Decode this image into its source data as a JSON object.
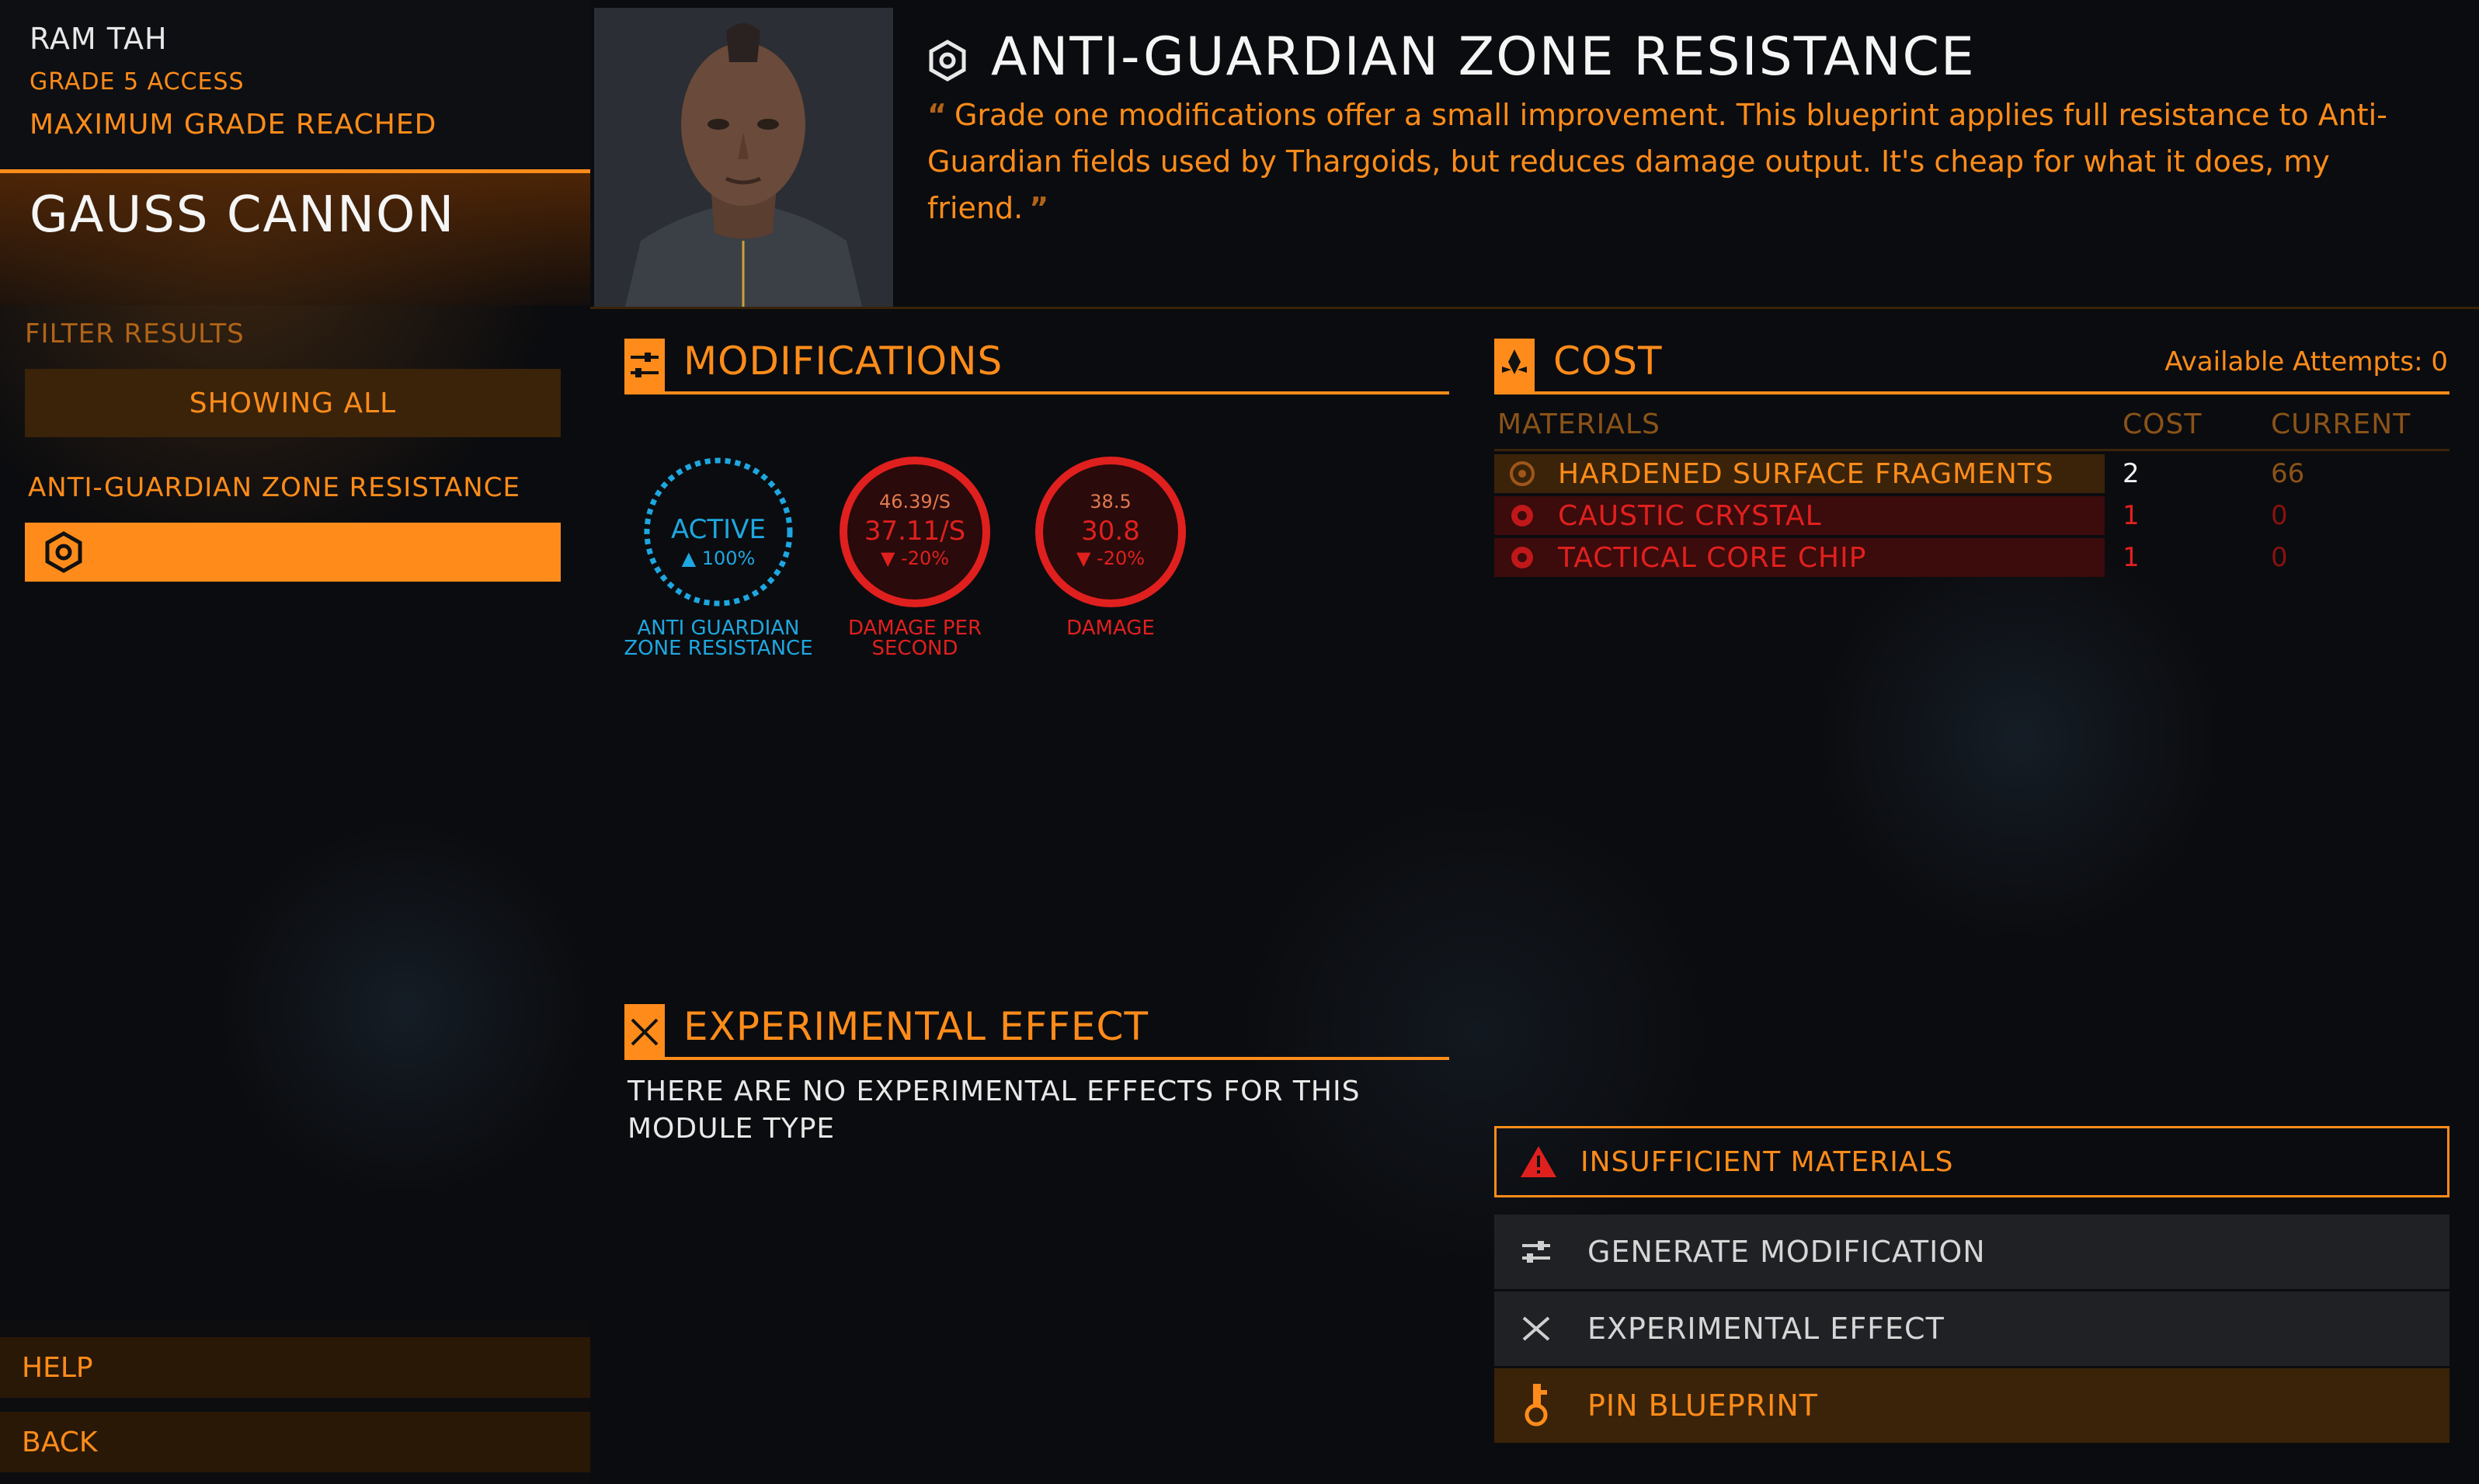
{
  "engineer": {
    "name": "RAM TAH",
    "grade_access": "GRADE 5 ACCESS",
    "status": "MAXIMUM GRADE REACHED"
  },
  "module": {
    "name": "GAUSS CANNON"
  },
  "filter": {
    "label": "FILTER RESULTS",
    "button_label": "SHOWING ALL"
  },
  "blueprint_list": {
    "group_label": "ANTI-GUARDIAN ZONE RESISTANCE",
    "selected_icon": "hexagon-icon"
  },
  "footer": {
    "help_label": "HELP",
    "back_label": "BACK"
  },
  "blueprint": {
    "title": "ANTI-GUARDIAN ZONE RESISTANCE",
    "quote_open": "“",
    "description": "Grade one modifications offer a small improvement. This blueprint applies full resistance to Anti-Guardian fields used by Thargoids, but reduces damage output. It's cheap for what it does, my friend.",
    "quote_close": "”"
  },
  "modifications": {
    "title": "MODIFICATIONS",
    "gauges": [
      {
        "main": "ACTIVE",
        "delta": "▲ 100%",
        "caption": "ANTI GUARDIAN ZONE RESISTANCE",
        "color": "#1ea7e1"
      },
      {
        "old": "46.39/S",
        "main": "37.11/S",
        "delta": "▼ -20%",
        "caption": "DAMAGE PER SECOND",
        "color": "#e0201e"
      },
      {
        "old": "38.5",
        "main": "30.8",
        "delta": "▼ -20%",
        "caption": "DAMAGE",
        "color": "#e0201e"
      }
    ]
  },
  "experimental": {
    "title": "EXPERIMENTAL EFFECT",
    "message": "THERE ARE NO EXPERIMENTAL EFFECTS FOR THIS MODULE TYPE"
  },
  "cost": {
    "title": "COST",
    "attempts": "Available Attempts: 0",
    "columns": [
      "MATERIALS",
      "COST",
      "CURRENT"
    ],
    "materials": [
      {
        "name": "HARDENED SURFACE FRAGMENTS",
        "cost": "2",
        "current": "66",
        "sufficient": true
      },
      {
        "name": "CAUSTIC CRYSTAL",
        "cost": "1",
        "current": "0",
        "sufficient": false
      },
      {
        "name": "TACTICAL CORE CHIP",
        "cost": "1",
        "current": "0",
        "sufficient": false
      }
    ]
  },
  "actions": {
    "alert": "INSUFFICIENT MATERIALS",
    "generate": "GENERATE MODIFICATION",
    "experimental": "EXPERIMENTAL EFFECT",
    "pin": "PIN BLUEPRINT"
  },
  "colors": {
    "accent": "#ff8c1a",
    "danger": "#e0201e",
    "info": "#1ea7e1"
  }
}
